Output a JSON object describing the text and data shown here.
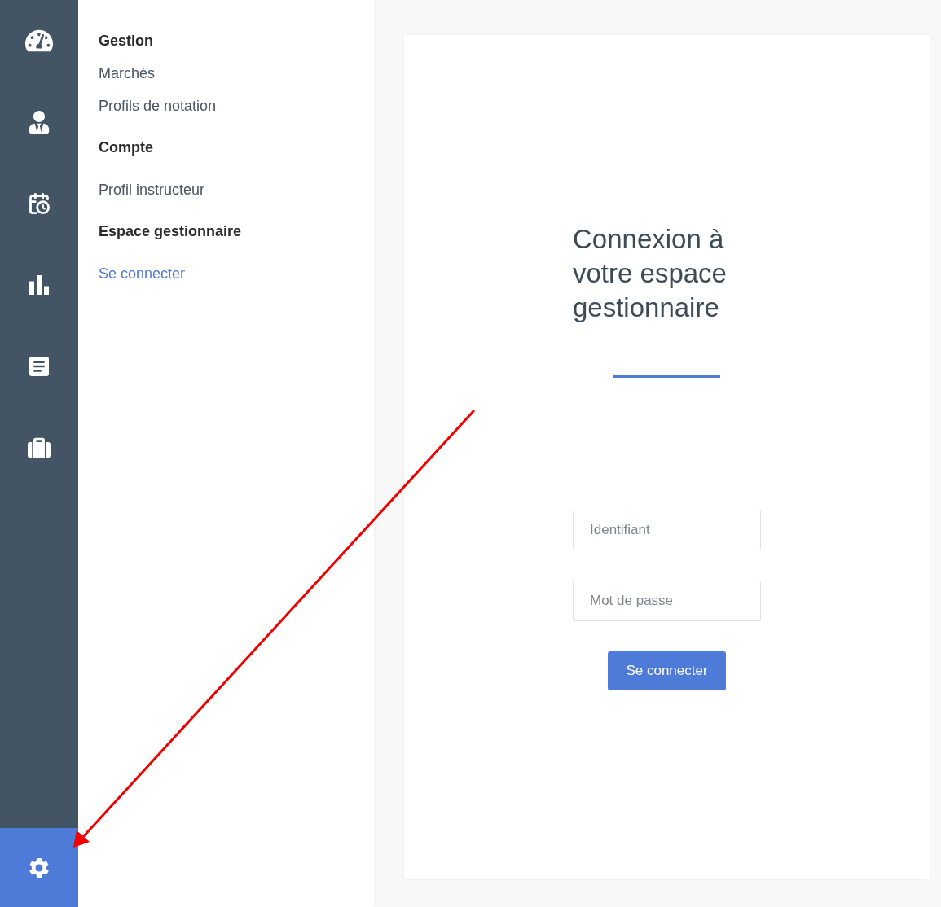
{
  "rail": [
    {
      "selected": false
    },
    {
      "selected": false
    },
    {
      "selected": false
    },
    {
      "selected": false
    },
    {
      "selected": false
    },
    {
      "selected": false
    },
    {
      "selected": true
    }
  ],
  "menu": [
    {
      "heading": "Gestion",
      "items": [
        {
          "label": "Marchés",
          "selected": false
        },
        {
          "label": "Profils de notation",
          "selected": false
        }
      ]
    },
    {
      "heading": "Compte",
      "items": [
        {
          "label": "Profil instructeur",
          "selected": false
        }
      ]
    },
    {
      "heading": "Espace gestionnaire",
      "items": [
        {
          "label": "Se connecter",
          "selected": true
        }
      ]
    }
  ],
  "login": {
    "title": "Connexion à votre espace gestionnaire",
    "fields": [
      {
        "placeholder": "Identifiant"
      },
      {
        "placeholder": "Mot de passe"
      }
    ],
    "button": "Se connecter"
  }
}
